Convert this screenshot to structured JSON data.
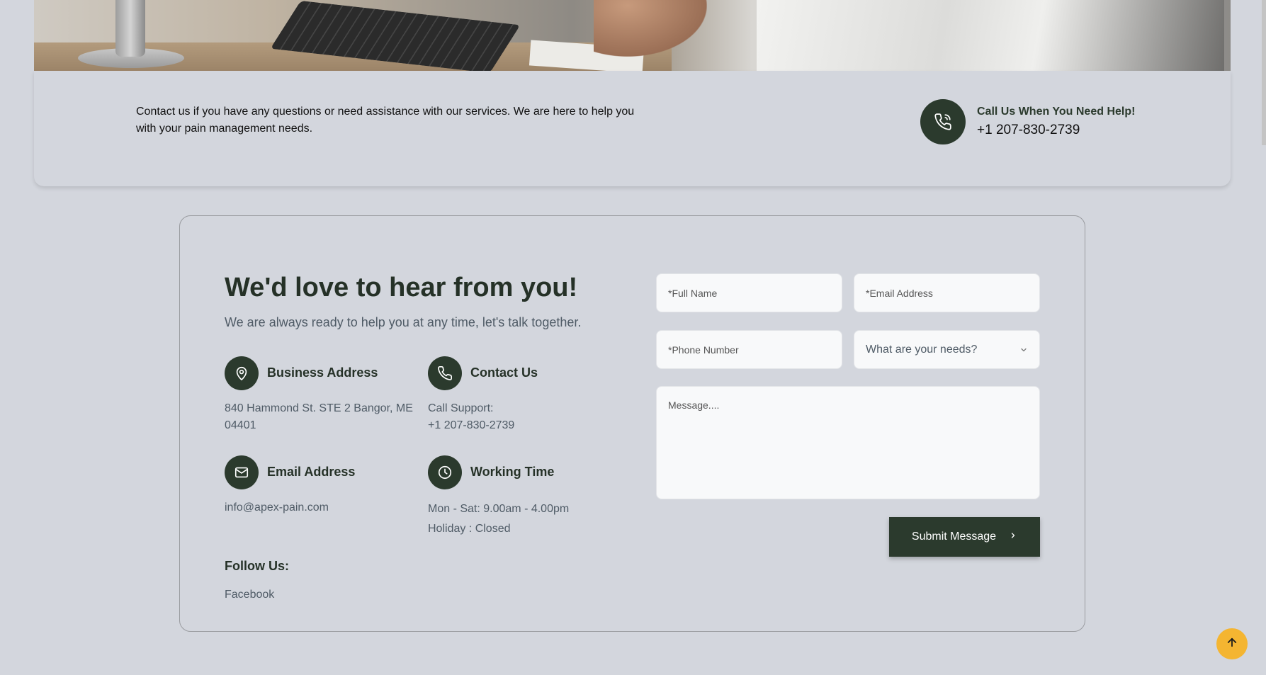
{
  "info_bar": {
    "text": "Contact us if you have any questions or need assistance with our services. We are here to help you with your pain management needs.",
    "call_title": "Call Us When You Need Help!",
    "call_phone": "+1 207-830-2739"
  },
  "contact": {
    "heading": "We'd love to hear from you!",
    "subheading": "We are always ready to help you at any time, let's talk together.",
    "business_address": {
      "title": "Business Address",
      "line1": "840 Hammond St. STE 2 Bangor, ME",
      "line2": "04401"
    },
    "contact_us": {
      "title": "Contact Us",
      "line1": "Call Support:",
      "line2": "+1 207-830-2739"
    },
    "email": {
      "title": "Email Address",
      "line1": "info@apex-pain.com"
    },
    "working_time": {
      "title": "Working Time",
      "line1": "Mon - Sat: 9.00am - 4.00pm",
      "line2": "Holiday : Closed"
    },
    "follow_title": "Follow Us:",
    "follow_link": "Facebook"
  },
  "form": {
    "full_name_placeholder": "*Full Name",
    "email_placeholder": "*Email Address",
    "phone_placeholder": "*Phone Number",
    "needs_selected": "What are your needs?",
    "message_placeholder": "Message....",
    "submit_label": "Submit Message"
  },
  "colors": {
    "accent": "#2b3a2d",
    "background": "#d3d6dd",
    "scroll_button": "#f4b531"
  },
  "icons": [
    "phone-call-icon",
    "map-pin-icon",
    "phone-icon",
    "mail-icon",
    "clock-icon",
    "chevron-down-icon",
    "chevron-right-icon",
    "arrow-up-icon"
  ]
}
